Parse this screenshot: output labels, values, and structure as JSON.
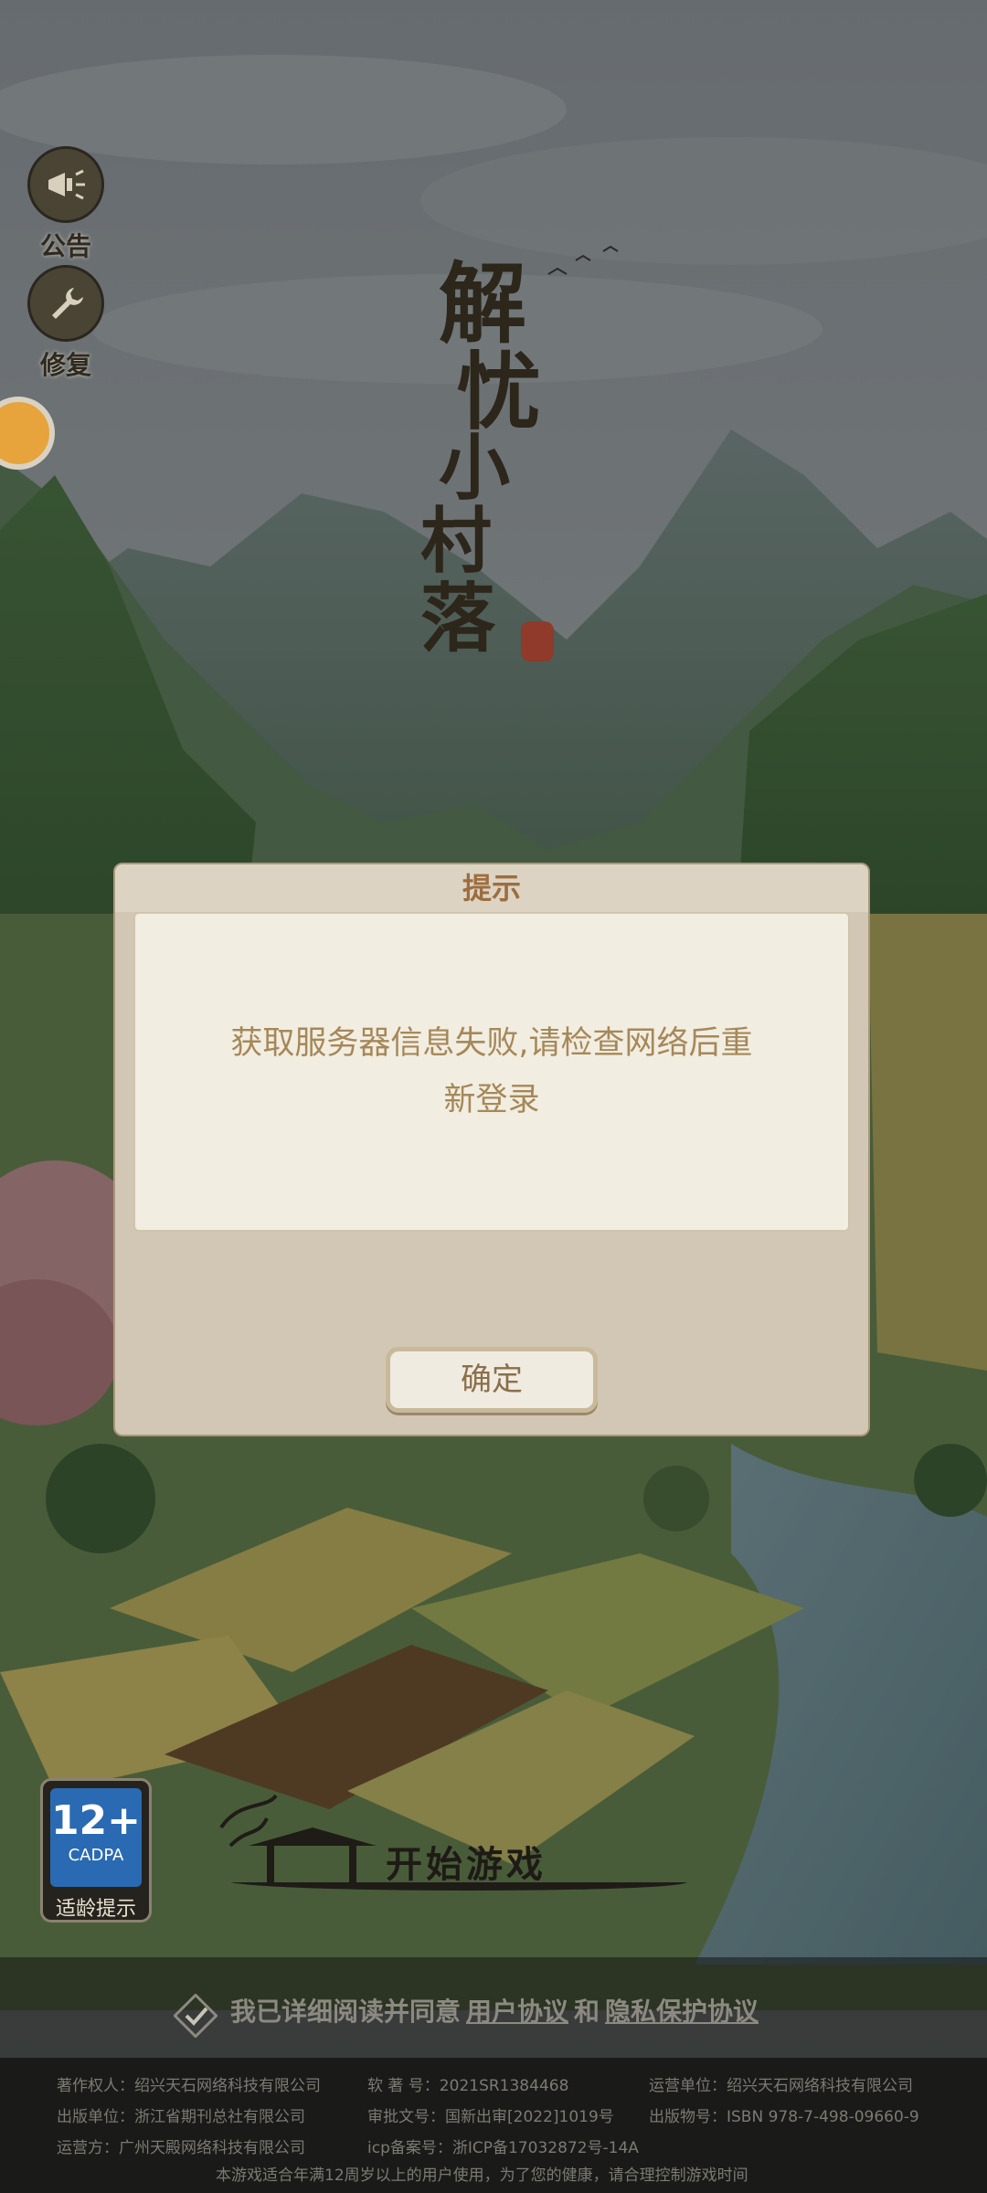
{
  "side_buttons": {
    "notice_label": "公告",
    "repair_label": "修复"
  },
  "title": {
    "chars": [
      "解",
      "忧",
      "小",
      "村",
      "落"
    ]
  },
  "dialog": {
    "title": "提示",
    "message": "获取服务器信息失败,请检查网络后重新登录",
    "confirm_label": "确定"
  },
  "age_rating": {
    "age": "12+",
    "org": "CADPA",
    "tip": "适龄提示"
  },
  "start_button": {
    "label": "开始游戏"
  },
  "agreement": {
    "prefix": "我已详细阅读并同意",
    "user_agreement": "用户协议",
    "and": "和",
    "privacy_agreement": "隐私保护协议"
  },
  "footer": {
    "copyright_owner": "著作权人：绍兴天石网络科技有限公司",
    "software_reg": "软  著  号：2021SR1384468",
    "operator_unit": "运营单位：绍兴天石网络科技有限公司",
    "publisher": "出版单位：浙江省期刊总社有限公司",
    "approval_no": "审批文号：国新出审[2022]1019号",
    "publication_no": "出版物号：ISBN 978-7-498-09660-9",
    "operator": "运营方：广州天殿网络科技有限公司",
    "icp": "icp备案号：浙ICP备17032872号-14A",
    "health_notice": "本游戏适合年满12周岁以上的用户使用，为了您的健康，请合理控制游戏时间"
  },
  "colors": {
    "dialog_title": "#9c6e3f",
    "dialog_text": "#a58859",
    "age_badge": "#2a6ab2"
  }
}
